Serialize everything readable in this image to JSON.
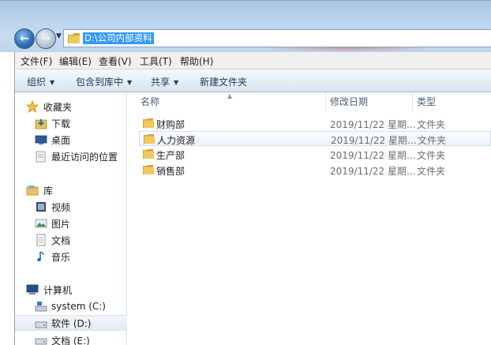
{
  "address": {
    "path": "D:\\公司内部资料"
  },
  "menu": [
    "文件(F)",
    "编辑(E)",
    "查看(V)",
    "工具(T)",
    "帮助(H)"
  ],
  "toolbar": {
    "organize": "组织",
    "include_in_library": "包含到库中",
    "share": "共享",
    "new_folder": "新建文件夹"
  },
  "nav": {
    "favorites": "收藏夹",
    "downloads": "下载",
    "desktop": "桌面",
    "recent": "最近访问的位置",
    "libraries": "库",
    "videos": "视频",
    "pictures": "图片",
    "documents": "文档",
    "music": "音乐",
    "computer": "计算机",
    "drive_c": "system (C:)",
    "drive_d": "软件 (D:)",
    "drive_e": "文档 (E:)"
  },
  "columns": {
    "name": "名称",
    "date": "修改日期",
    "type": "类型"
  },
  "files": [
    {
      "name": "财购部",
      "date": "2019/11/22 星期...",
      "type": "文件夹"
    },
    {
      "name": "人力资源",
      "date": "2019/11/22 星期...",
      "type": "文件夹"
    },
    {
      "name": "生产部",
      "date": "2019/11/22 星期...",
      "type": "文件夹"
    },
    {
      "name": "销售部",
      "date": "2019/11/22 星期...",
      "type": "文件夹"
    }
  ],
  "colors": {
    "selection": "#3399ff",
    "folder": "#e8b84a",
    "hover": "#ecf3fb"
  }
}
